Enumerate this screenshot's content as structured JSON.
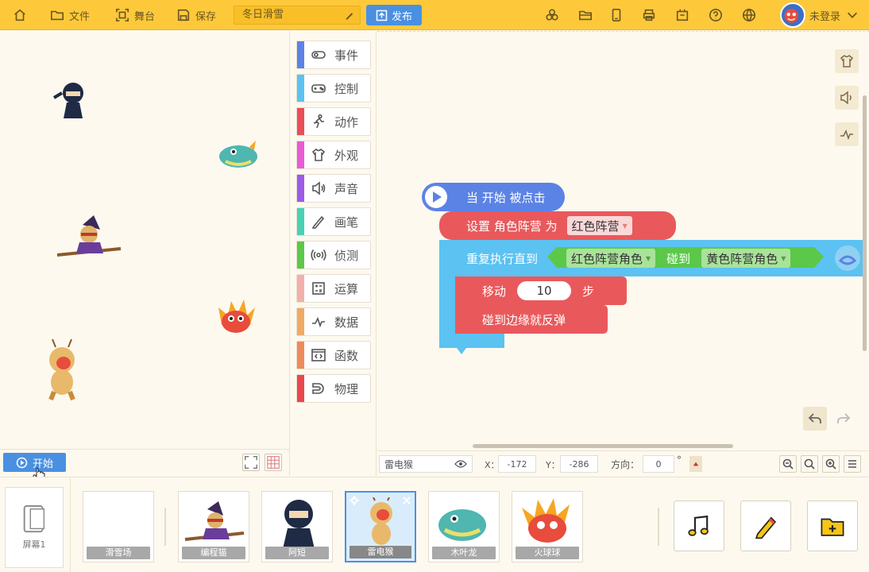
{
  "topbar": {
    "file": "文件",
    "stage": "舞台",
    "save": "保存",
    "project_name": "冬日滑雪",
    "publish": "发布",
    "login": "未登录"
  },
  "categories": [
    {
      "label": "事件",
      "color": "#5b83e6",
      "icon": "toggle-icon"
    },
    {
      "label": "控制",
      "color": "#5bc2f2",
      "icon": "gamepad-icon"
    },
    {
      "label": "动作",
      "color": "#e94f55",
      "icon": "running-icon"
    },
    {
      "label": "外观",
      "color": "#e95bd6",
      "icon": "shirt-icon"
    },
    {
      "label": "声音",
      "color": "#9b5be6",
      "icon": "speaker-icon"
    },
    {
      "label": "画笔",
      "color": "#4ad1b2",
      "icon": "pencil-icon"
    },
    {
      "label": "侦测",
      "color": "#5bc84a",
      "icon": "sensor-icon"
    },
    {
      "label": "运算",
      "color": "#f2b0ac",
      "icon": "calculator-icon"
    },
    {
      "label": "数据",
      "color": "#efaa66",
      "icon": "chart-icon"
    },
    {
      "label": "函数",
      "color": "#ef8a5b",
      "icon": "code-icon"
    },
    {
      "label": "物理",
      "color": "#e9474f",
      "icon": "magnet-icon"
    }
  ],
  "blocks": {
    "hat": "当 开始 被点击",
    "set_label": "设置 角色阵营 为",
    "set_value": "红色阵营",
    "repeat_label": "重复执行直到",
    "touch_a": "红色阵营角色",
    "touch_mid": "碰到",
    "touch_b": "黄色阵营角色",
    "move_label": "移动",
    "move_value": "10",
    "move_unit": "步",
    "bounce": "碰到边缘就反弹"
  },
  "stage": {
    "start": "开始"
  },
  "props": {
    "sprite": "雷电猴",
    "x_label": "X：",
    "x": "-172",
    "y_label": "Y：",
    "y": "-286",
    "dir_label": "方向：",
    "dir": "0",
    "deg": "°"
  },
  "sprites": {
    "screen": "屏幕1",
    "items": [
      {
        "name": "滑雪场"
      },
      {
        "name": "编程猫"
      },
      {
        "name": "阿短"
      },
      {
        "name": "雷电猴"
      },
      {
        "name": "木叶龙"
      },
      {
        "name": "火球球"
      }
    ]
  }
}
